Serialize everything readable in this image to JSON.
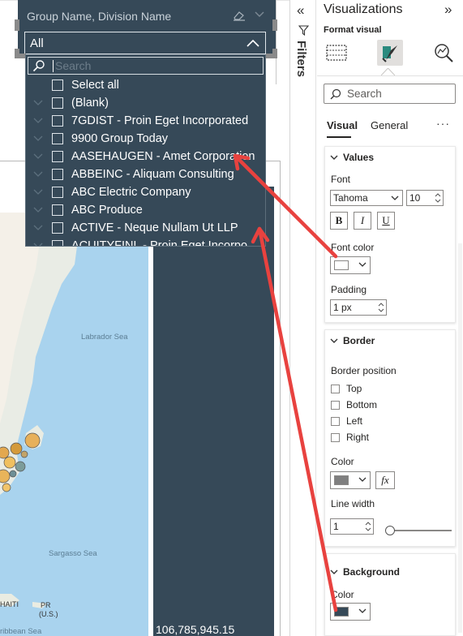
{
  "slicer": {
    "title": "Group Name, Division Name",
    "selected": "All",
    "search_placeholder": "Search",
    "items": [
      {
        "label": "Select all",
        "expandable": false
      },
      {
        "label": "(Blank)",
        "expandable": true
      },
      {
        "label": "7GDIST - Proin Eget Incorporated",
        "expandable": true
      },
      {
        "label": "9900 Group Today",
        "expandable": true
      },
      {
        "label": "AASEHAUGEN - Amet Corporation",
        "expandable": true
      },
      {
        "label": "ABBEINC - Aliquam Consulting",
        "expandable": true
      },
      {
        "label": "ABC Electric Company",
        "expandable": true
      },
      {
        "label": "ABC Produce",
        "expandable": true
      },
      {
        "label": "ACTIVE - Neque Nullam Ut LLP",
        "expandable": true
      },
      {
        "label": "ACUITYFINL - Proin Eget Incorpo",
        "expandable": true
      }
    ]
  },
  "map": {
    "labels": [
      "Labrador Sea",
      "Sargasso Sea",
      "HAITI",
      "PR",
      "(U.S.)",
      "ribbean Sea"
    ]
  },
  "total_value": "106,785,945.15",
  "filters": {
    "label": "Filters",
    "collapse_glyph": "«"
  },
  "visualizations": {
    "title": "Visualizations",
    "expand_glyph": "»",
    "format_visual_label": "Format visual",
    "search_placeholder": "Search",
    "tabs": [
      "Visual",
      "General"
    ],
    "more_glyph": "···",
    "values": {
      "header": "Values",
      "font_label": "Font",
      "font_family": "Tahoma",
      "font_size": "10",
      "bold": "B",
      "italic": "I",
      "underline": "U",
      "font_color_label": "Font color",
      "font_color": "#ffffff",
      "padding_label": "Padding",
      "padding_value": "1 px"
    },
    "border": {
      "header": "Border",
      "position_label": "Border position",
      "positions": [
        "Top",
        "Bottom",
        "Left",
        "Right"
      ],
      "color_label": "Color",
      "color": "#7f7f7f",
      "fx": "fx",
      "line_width_label": "Line width",
      "line_width_value": "1",
      "line_width_slider": 0
    },
    "background": {
      "header": "Background",
      "color_label": "Color",
      "color": "#364958"
    }
  },
  "colors": {
    "slicer_bg": "#364958",
    "accent_arrow": "#e8423f",
    "map_water": "#a9d3ee"
  }
}
